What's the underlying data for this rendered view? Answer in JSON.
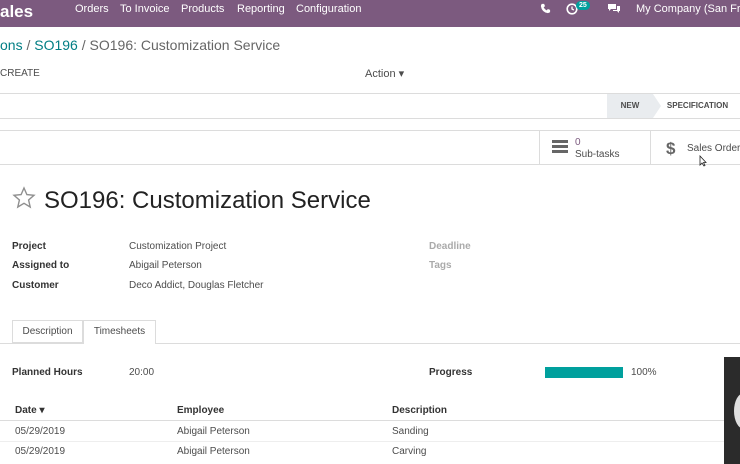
{
  "navbar": {
    "app_name": "ales",
    "menu": [
      "Orders",
      "To Invoice",
      "Products",
      "Reporting",
      "Configuration"
    ],
    "phone_icon": "phone-icon",
    "activity_icon": "clock-icon",
    "activity_count": "25",
    "chat_icon": "chat-icon",
    "company": "My Company (San Fran"
  },
  "breadcrumb": {
    "parent": "ons",
    "sep1": "/",
    "middle": "SO196",
    "sep2": "/",
    "current": "SO196: Customization Service"
  },
  "control": {
    "create_label": "CREATE",
    "action_label": "Action ▾"
  },
  "statusbar": {
    "stages": [
      "NEW",
      "SPECIFICATION"
    ]
  },
  "smart_buttons": {
    "subtasks_count": "0",
    "subtasks_label": "Sub-tasks",
    "sales_order_label": "Sales Order"
  },
  "record": {
    "title": "SO196: Customization Service",
    "favorite_icon": "star-icon",
    "fields": {
      "project_label": "Project",
      "project_value": "Customization Project",
      "assigned_label": "Assigned to",
      "assigned_value": "Abigail Peterson",
      "customer_label": "Customer",
      "customer_value": "Deco Addict, Douglas Fletcher",
      "deadline_label": "Deadline",
      "tags_label": "Tags"
    }
  },
  "tabs": [
    "Description",
    "Timesheets"
  ],
  "timesheets": {
    "planned_label": "Planned Hours",
    "planned_value": "20:00",
    "progress_label": "Progress",
    "progress_value": "100%",
    "progress_fraction": 1.0,
    "progress_color": "#00a09d",
    "columns": [
      "Date ▾",
      "Employee",
      "Description"
    ],
    "rows": [
      {
        "date": "05/29/2019",
        "employee": "Abigail Peterson",
        "description": "Sanding"
      },
      {
        "date": "05/29/2019",
        "employee": "Abigail Peterson",
        "description": "Carving"
      }
    ]
  },
  "colors": {
    "navbar": "#7c5a7f",
    "link": "#017e84",
    "accent": "#00a09d"
  }
}
